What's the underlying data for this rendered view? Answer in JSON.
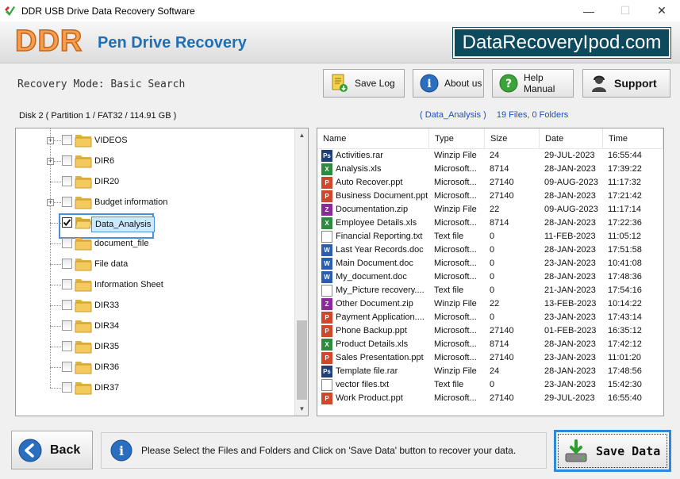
{
  "window": {
    "title": "DDR USB Drive Data Recovery Software",
    "minimize_glyph": "—",
    "maximize_glyph": "☐",
    "close_glyph": "✕"
  },
  "banner": {
    "logo": "DDR",
    "product_name": "Pen Drive Recovery",
    "website": "DataRecoveryIpod.com"
  },
  "toolbar": {
    "mode_label": "Recovery Mode: Basic Search",
    "save_log": "Save Log",
    "about_us": "About us",
    "help_manual": "Help Manual",
    "support": "Support"
  },
  "disk_label": "Disk 2 ( Partition 1 / FAT32 / 114.91 GB )",
  "folder_info": {
    "folder": "( Data_Analysis )",
    "counts": "19 Files, 0 Folders"
  },
  "tree": {
    "items": [
      {
        "label": "VIDEOS",
        "expandable": true,
        "checked": false,
        "selected": false
      },
      {
        "label": "DIR6",
        "expandable": true,
        "checked": false,
        "selected": false
      },
      {
        "label": "DIR20",
        "expandable": false,
        "checked": false,
        "selected": false
      },
      {
        "label": "Budget information",
        "expandable": true,
        "checked": false,
        "selected": false
      },
      {
        "label": "Data_Analysis",
        "expandable": false,
        "checked": true,
        "selected": true
      },
      {
        "label": "document_file",
        "expandable": false,
        "checked": false,
        "selected": false
      },
      {
        "label": "File data",
        "expandable": false,
        "checked": false,
        "selected": false
      },
      {
        "label": "Information Sheet",
        "expandable": false,
        "checked": false,
        "selected": false
      },
      {
        "label": "DIR33",
        "expandable": false,
        "checked": false,
        "selected": false
      },
      {
        "label": "DIR34",
        "expandable": false,
        "checked": false,
        "selected": false
      },
      {
        "label": "DIR35",
        "expandable": false,
        "checked": false,
        "selected": false
      },
      {
        "label": "DIR36",
        "expandable": false,
        "checked": false,
        "selected": false
      },
      {
        "label": "DIR37",
        "expandable": false,
        "checked": false,
        "selected": false
      }
    ]
  },
  "table": {
    "columns": [
      "Name",
      "Type",
      "Size",
      "Date",
      "Time"
    ],
    "rows": [
      {
        "icon": "ps",
        "name": "Activities.rar",
        "type": "Winzip File",
        "size": "24",
        "date": "29-JUL-2023",
        "time": "16:55:44"
      },
      {
        "icon": "xls",
        "name": "Analysis.xls",
        "type": "Microsoft...",
        "size": "8714",
        "date": "28-JAN-2023",
        "time": "17:39:22"
      },
      {
        "icon": "ppt",
        "name": "Auto Recover.ppt",
        "type": "Microsoft...",
        "size": "27140",
        "date": "09-AUG-2023",
        "time": "11:17:32"
      },
      {
        "icon": "ppt",
        "name": "Business Document.ppt",
        "type": "Microsoft...",
        "size": "27140",
        "date": "28-JAN-2023",
        "time": "17:21:42"
      },
      {
        "icon": "zip",
        "name": "Documentation.zip",
        "type": "Winzip File",
        "size": "22",
        "date": "09-AUG-2023",
        "time": "11:17:14"
      },
      {
        "icon": "xls",
        "name": "Employee Details.xls",
        "type": "Microsoft...",
        "size": "8714",
        "date": "28-JAN-2023",
        "time": "17:22:36"
      },
      {
        "icon": "txt",
        "name": "Financial Reporting.txt",
        "type": "Text file",
        "size": "0",
        "date": "11-FEB-2023",
        "time": "11:05:12"
      },
      {
        "icon": "doc",
        "name": "Last Year Records.doc",
        "type": "Microsoft...",
        "size": "0",
        "date": "28-JAN-2023",
        "time": "17:51:58"
      },
      {
        "icon": "doc",
        "name": "Main Document.doc",
        "type": "Microsoft...",
        "size": "0",
        "date": "23-JAN-2023",
        "time": "10:41:08"
      },
      {
        "icon": "doc",
        "name": "My_document.doc",
        "type": "Microsoft...",
        "size": "0",
        "date": "28-JAN-2023",
        "time": "17:48:36"
      },
      {
        "icon": "txt",
        "name": "My_Picture recovery....",
        "type": "Text file",
        "size": "0",
        "date": "21-JAN-2023",
        "time": "17:54:16"
      },
      {
        "icon": "zip",
        "name": "Other Document.zip",
        "type": "Winzip File",
        "size": "22",
        "date": "13-FEB-2023",
        "time": "10:14:22"
      },
      {
        "icon": "ppt",
        "name": "Payment Application....",
        "type": "Microsoft...",
        "size": "0",
        "date": "23-JAN-2023",
        "time": "17:43:14"
      },
      {
        "icon": "ppt",
        "name": "Phone Backup.ppt",
        "type": "Microsoft...",
        "size": "27140",
        "date": "01-FEB-2023",
        "time": "16:35:12"
      },
      {
        "icon": "xls",
        "name": "Product Details.xls",
        "type": "Microsoft...",
        "size": "8714",
        "date": "28-JAN-2023",
        "time": "17:42:12"
      },
      {
        "icon": "ppt",
        "name": "Sales Presentation.ppt",
        "type": "Microsoft...",
        "size": "27140",
        "date": "23-JAN-2023",
        "time": "11:01:20"
      },
      {
        "icon": "ps",
        "name": "Template file.rar",
        "type": "Winzip File",
        "size": "24",
        "date": "28-JAN-2023",
        "time": "17:48:56"
      },
      {
        "icon": "txt",
        "name": "vector files.txt",
        "type": "Text file",
        "size": "0",
        "date": "23-JAN-2023",
        "time": "15:42:30"
      },
      {
        "icon": "ppt",
        "name": "Work Product.ppt",
        "type": "Microsoft...",
        "size": "27140",
        "date": "29-JUL-2023",
        "time": "16:55:40"
      }
    ]
  },
  "footer": {
    "back": "Back",
    "message": "Please Select the Files and Folders and Click on 'Save Data' button to recover your data.",
    "save_data": "Save Data"
  },
  "colors": {
    "site_badge_bg": "#0e4a5e",
    "product_blue": "#1f6fb5",
    "logo_orange": "#f0a050",
    "selection_blue": "#4a8fd8",
    "info_blue": "#1d4fc4"
  }
}
